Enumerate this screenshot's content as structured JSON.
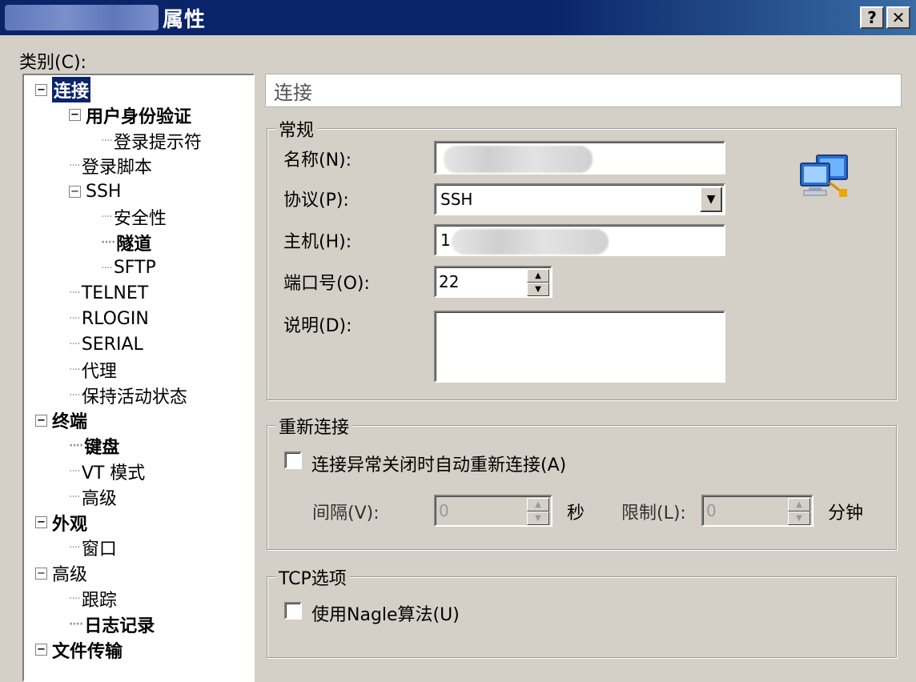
{
  "window": {
    "title": "属性",
    "help_glyph": "?",
    "close_glyph": "✕"
  },
  "category_label": "类别(C):",
  "tree": [
    {
      "label": "连接",
      "level": 0,
      "expander": "−",
      "bold": true,
      "selected": true
    },
    {
      "label": "用户身份验证",
      "level": 1,
      "expander": "−",
      "bold": true
    },
    {
      "label": "登录提示符",
      "level": 2
    },
    {
      "label": "登录脚本",
      "level": 1
    },
    {
      "label": "SSH",
      "level": 1,
      "expander": "−"
    },
    {
      "label": "安全性",
      "level": 2
    },
    {
      "label": "隧道",
      "level": 2,
      "bold": true
    },
    {
      "label": "SFTP",
      "level": 2
    },
    {
      "label": "TELNET",
      "level": 1
    },
    {
      "label": "RLOGIN",
      "level": 1
    },
    {
      "label": "SERIAL",
      "level": 1
    },
    {
      "label": "代理",
      "level": 1
    },
    {
      "label": "保持活动状态",
      "level": 1
    },
    {
      "label": "终端",
      "level": 0,
      "expander": "−",
      "bold": true
    },
    {
      "label": "键盘",
      "level": 1,
      "bold": true
    },
    {
      "label": "VT 模式",
      "level": 1
    },
    {
      "label": "高级",
      "level": 1
    },
    {
      "label": "外观",
      "level": 0,
      "expander": "−",
      "bold": true
    },
    {
      "label": "窗口",
      "level": 1
    },
    {
      "label": "高级",
      "level": 0,
      "expander": "−"
    },
    {
      "label": "跟踪",
      "level": 1
    },
    {
      "label": "日志记录",
      "level": 1,
      "bold": true
    },
    {
      "label": "文件传输",
      "level": 0,
      "expander": "−",
      "bold": true
    }
  ],
  "section_title": "连接",
  "general": {
    "title": "常规",
    "name_label": "名称(N):",
    "name_value": "",
    "protocol_label": "协议(P):",
    "protocol_value": "SSH",
    "host_label": "主机(H):",
    "host_value": "1",
    "port_label": "端口号(O):",
    "port_value": "22",
    "desc_label": "说明(D):",
    "desc_value": ""
  },
  "reconnect": {
    "title": "重新连接",
    "auto_label": "连接异常关闭时自动重新连接(A)",
    "interval_label": "间隔(V):",
    "interval_value": "0",
    "interval_unit": "秒",
    "limit_label": "限制(L):",
    "limit_value": "0",
    "limit_unit": "分钟"
  },
  "tcp": {
    "title": "TCP选项",
    "nagle_label": "使用Nagle算法(U)"
  },
  "icons": {
    "computer": "network-computers-icon",
    "dropdown": "chevron-down-icon"
  }
}
